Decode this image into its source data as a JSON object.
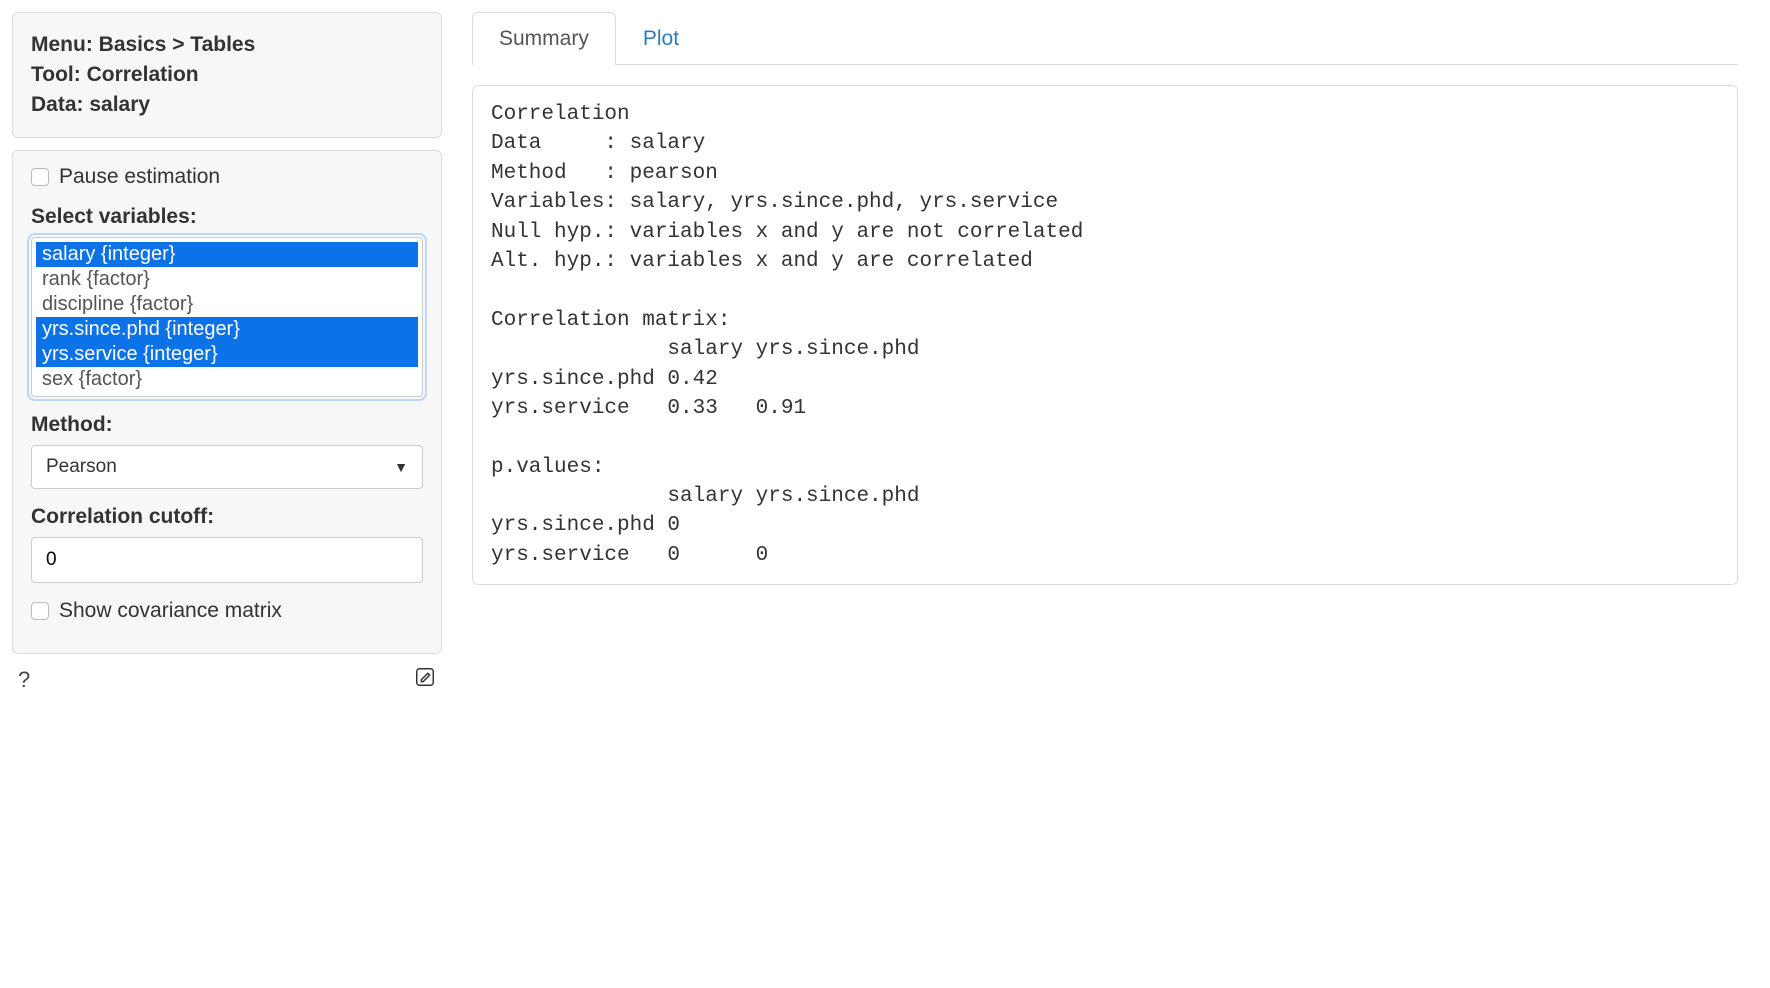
{
  "sidebar": {
    "header": {
      "menu": "Menu: Basics > Tables",
      "tool": "Tool: Correlation",
      "data": "Data: salary"
    },
    "pause_label": "Pause estimation",
    "select_vars_label": "Select variables:",
    "variables": [
      {
        "label": "salary {integer}",
        "selected": true
      },
      {
        "label": "rank {factor}",
        "selected": false
      },
      {
        "label": "discipline {factor}",
        "selected": false
      },
      {
        "label": "yrs.since.phd {integer}",
        "selected": true
      },
      {
        "label": "yrs.service {integer}",
        "selected": true
      },
      {
        "label": "sex {factor}",
        "selected": false
      }
    ],
    "method_label": "Method:",
    "method_value": "Pearson",
    "cutoff_label": "Correlation cutoff:",
    "cutoff_value": "0",
    "covariance_label": "Show covariance matrix",
    "help_icon": "?"
  },
  "tabs": {
    "summary": "Summary",
    "plot": "Plot"
  },
  "output_text": "Correlation\nData     : salary\nMethod   : pearson\nVariables: salary, yrs.since.phd, yrs.service\nNull hyp.: variables x and y are not correlated\nAlt. hyp.: variables x and y are correlated\n\nCorrelation matrix:\n              salary yrs.since.phd\nyrs.since.phd 0.42\nyrs.service   0.33   0.91\n\np.values:\n              salary yrs.since.phd\nyrs.since.phd 0\nyrs.service   0      0"
}
